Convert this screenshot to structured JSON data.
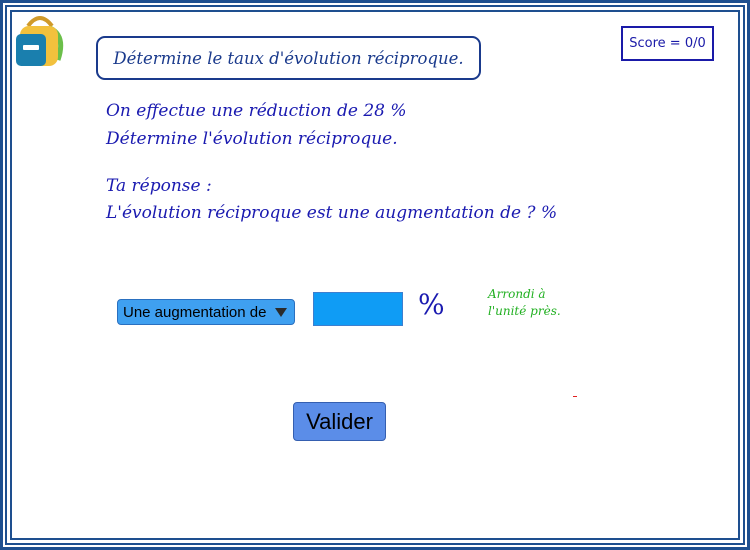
{
  "header": {
    "title": "Détermine le taux d'évolution réciproque.",
    "score": "Score = 0/0"
  },
  "statement": {
    "line1": "On effectue une réduction de 28 %",
    "line2": "Détermine l'évolution réciproque."
  },
  "answer_prompt": {
    "line1": "Ta réponse :",
    "line2": "L'évolution réciproque est une augmentation de ? %"
  },
  "form": {
    "dropdown_selected": "Une augmentation de",
    "input_value": "",
    "percent_sign": "%",
    "hint_line1": "Arrondi à",
    "hint_line2": "l'unité près.",
    "submit_label": "Valider"
  },
  "icons": {
    "app_icon": "backpack-icon",
    "dropdown_icon": "triangle-down-icon"
  },
  "colors": {
    "frame": "#1e4f8f",
    "text_blue": "#1a1ab0",
    "input_blue": "#0f9cf5",
    "button_blue": "#5b8de8",
    "hint_green": "#22b022"
  }
}
